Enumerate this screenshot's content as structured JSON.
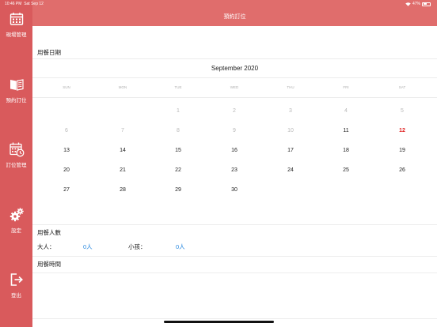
{
  "status_bar": {
    "time": "10:46 PM",
    "date": "Sat Sep 12",
    "battery": "47%",
    "battery_level": 0.47
  },
  "sidebar": {
    "items": [
      {
        "label": "現場管理",
        "icon": "calendar-grid-icon"
      },
      {
        "label": "預約訂位",
        "icon": "open-book-icon"
      },
      {
        "label": "訂位管理",
        "icon": "calendar-clock-icon"
      },
      {
        "label": "設定",
        "icon": "gears-icon"
      },
      {
        "label": "登出",
        "icon": "logout-icon"
      }
    ]
  },
  "header": {
    "title": "預約訂位"
  },
  "date_section": {
    "title": "用餐日期"
  },
  "calendar": {
    "month_title": "September 2020",
    "weekdays": [
      "SUN",
      "MON",
      "TUE",
      "WED",
      "THU",
      "FRI",
      "SAT"
    ],
    "weeks": [
      [
        null,
        null,
        "1",
        "2",
        "3",
        "4",
        "5"
      ],
      [
        "6",
        "7",
        "8",
        "9",
        "10",
        "11",
        "12"
      ],
      [
        "13",
        "14",
        "15",
        "16",
        "17",
        "18",
        "19"
      ],
      [
        "20",
        "21",
        "22",
        "23",
        "24",
        "25",
        "26"
      ],
      [
        "27",
        "28",
        "29",
        "30",
        null,
        null,
        null
      ]
    ],
    "disabled_days": [
      "1",
      "2",
      "3",
      "4",
      "5",
      "6",
      "7",
      "8",
      "9",
      "10"
    ],
    "today": "12",
    "colors": {
      "today": "#e02020",
      "disabled": "#b8b8b8"
    }
  },
  "party_section": {
    "title": "用餐人數",
    "adult_label": "大人：",
    "adult_value": "0人",
    "child_label": "小孩：",
    "child_value": "0人"
  },
  "time_section": {
    "title": "用餐時間"
  },
  "colors": {
    "sidebar": "#d95a5c",
    "header": "#e06d6c",
    "link": "#2a8ae0"
  }
}
